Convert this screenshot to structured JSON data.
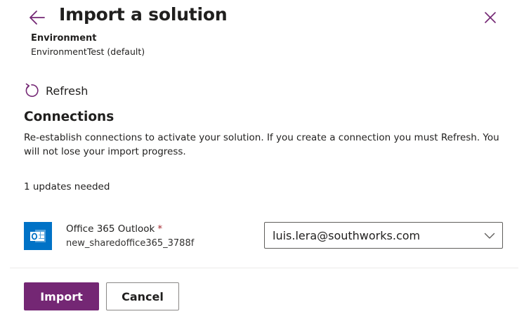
{
  "header": {
    "title": "Import a solution",
    "back_icon": "arrow-left-icon",
    "close_icon": "close-icon"
  },
  "environment": {
    "label": "Environment",
    "value": "EnvironmentTest (default)"
  },
  "refresh": {
    "label": "Refresh",
    "icon": "refresh-icon"
  },
  "connections": {
    "title": "Connections",
    "description": "Re-establish connections to activate your solution. If you create a connection you must Refresh. You will not lose your import progress.",
    "updates_needed": "1 updates needed",
    "items": [
      {
        "name": "Office 365 Outlook",
        "required_marker": "*",
        "id": "new_sharedoffice365_3788f",
        "icon": "outlook-icon",
        "selected_connection": "luis.lera@southworks.com"
      }
    ]
  },
  "footer": {
    "import_label": "Import",
    "cancel_label": "Cancel"
  },
  "colors": {
    "accent": "#742774",
    "text": "#201f1e",
    "outlook_blue": "#0072c6",
    "required": "#a4262c"
  }
}
